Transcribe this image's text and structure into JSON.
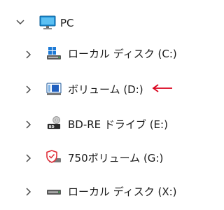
{
  "tree": {
    "root": {
      "label": "PC",
      "expanded": true,
      "icon": "monitor-icon"
    },
    "drives": [
      {
        "label": "ローカル ディスク (C:)",
        "icon": "windows-drive-icon",
        "expanded": false
      },
      {
        "label": "ボリューム (D:)",
        "icon": "volume-drive-icon",
        "expanded": false
      },
      {
        "label": "BD-RE ドライブ (E:)",
        "icon": "bd-drive-icon",
        "expanded": false
      },
      {
        "label": "750ボリューム (G:)",
        "icon": "shield-drive-icon",
        "expanded": false
      },
      {
        "label": "ローカル ディスク (X:)",
        "icon": "drive-icon",
        "expanded": false
      }
    ]
  },
  "annotation": {
    "icon": "red-arrow-icon",
    "color": "#d9001b"
  },
  "colors": {
    "monitor": "#1f8fd6",
    "chevron": "#4d4d4d",
    "text": "#1a1a1a",
    "shield": "#e0313b"
  }
}
